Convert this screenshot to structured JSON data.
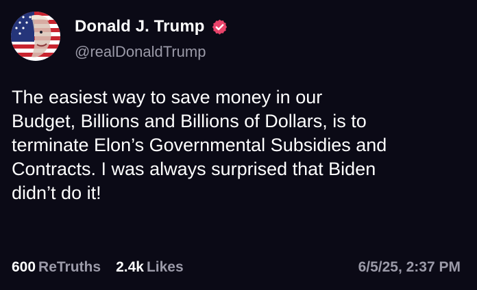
{
  "author": {
    "display_name": "Donald J. Trump",
    "handle": "@realDonaldTrump",
    "verified_icon": "verified-badge-icon",
    "avatar_icon": "flag-portrait-avatar"
  },
  "post": {
    "text": "The easiest way to save money in our\nBudget, Billions and Billions of Dollars, is to\nterminate Elon’s Governmental Subsidies and\nContracts. I was always surprised that Biden\ndidn’t do it!"
  },
  "stats": {
    "retruths_count": "600",
    "retruths_label": "ReTruths",
    "likes_count": "2.4k",
    "likes_label": "Likes"
  },
  "timestamp": "6/5/25, 2:37 PM",
  "colors": {
    "background": "#0b0a16",
    "primary_text": "#ffffff",
    "secondary_text": "#9b9aa8",
    "verified_badge": "#e8436a"
  }
}
